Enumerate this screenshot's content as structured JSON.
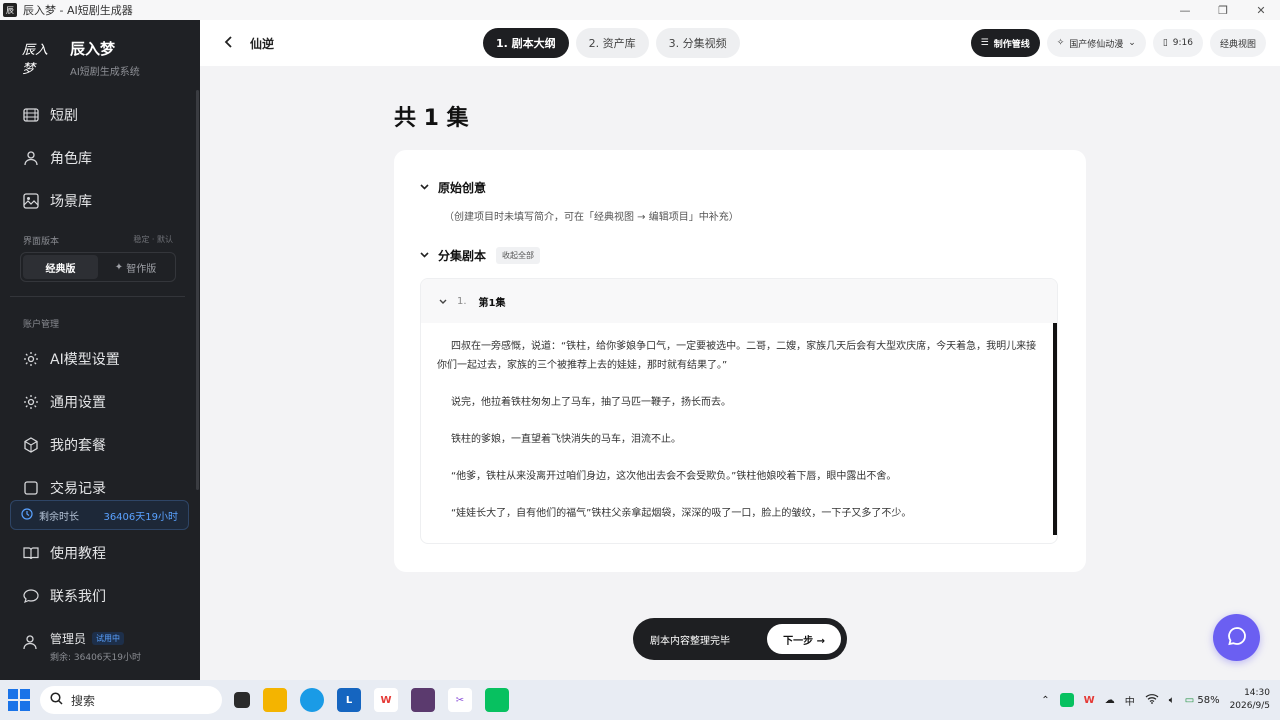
{
  "window": {
    "title": "辰入梦 - AI短剧生成器",
    "controls": [
      "—",
      "❐",
      "✕"
    ]
  },
  "sidebar": {
    "brand": {
      "logo": "辰入梦",
      "name": "辰入梦",
      "subtitle": "AI短剧生成系统"
    },
    "nav": [
      {
        "label": "短剧",
        "icon": "film-icon"
      },
      {
        "label": "角色库",
        "icon": "person-icon"
      },
      {
        "label": "场景库",
        "icon": "image-icon"
      }
    ],
    "version": {
      "label": "界面版本",
      "meta": "稳定 · 默认",
      "options": [
        "经典版",
        "智作版"
      ],
      "selected": "经典版"
    },
    "account_label": "账户管理",
    "account_nav": [
      {
        "label": "AI模型设置",
        "icon": "gear-icon"
      },
      {
        "label": "通用设置",
        "icon": "gear-icon"
      },
      {
        "label": "我的套餐",
        "icon": "box-icon"
      },
      {
        "label": "交易记录",
        "icon": "receipt-icon"
      }
    ],
    "remaining": {
      "label": "剩余时长",
      "value": "36406天19小时"
    },
    "bottom_nav": [
      {
        "label": "使用教程",
        "icon": "book-icon"
      },
      {
        "label": "联系我们",
        "icon": "chat-icon"
      }
    ],
    "user": {
      "name": "管理员",
      "badge": "试用中",
      "sub": "剩余: 36406天19小时"
    }
  },
  "header": {
    "project": "仙逆",
    "steps": [
      "1. 剧本大纲",
      "2. 资产库",
      "3. 分集视频"
    ],
    "active_step": 0,
    "pipeline": "制作管线",
    "style": "国产修仙动漫",
    "ratio": "9:16",
    "classic_view": "经典视图"
  },
  "main": {
    "title": "共 1 集",
    "original_idea": {
      "label": "原始创意",
      "hint": "（创建项目时未填写简介，可在「经典视图 → 编辑项目」中补充）"
    },
    "episodes_section": {
      "label": "分集剧本",
      "collapse_all": "收起全部"
    },
    "episode": {
      "num": "1.",
      "title": "第1集",
      "paragraphs": [
        "四叔在一旁感慨，说道：“铁柱，给你爹娘争口气，一定要被选中。二哥，二嫂，家族几天后会有大型欢庆席，今天着急，我明儿来接你们一起过去，家族的三个被推荐上去的娃娃，那时就有结果了。”",
        "说完，他拉着铁柱匆匆上了马车，抽了马匹一鞭子，扬长而去。",
        "铁柱的爹娘，一直望着飞快消失的马车，泪流不止。",
        "“他爹，铁柱从来没离开过咱们身边，这次他出去会不会受欺负。”铁柱他娘咬着下唇，眼中露出不舍。",
        "“娃娃长大了，自有他们的福气”铁柱父亲拿起烟袋，深深的吸了一口，脸上的皱纹，一下子又多了不少。"
      ]
    }
  },
  "action_bar": {
    "text": "剧本内容整理完毕",
    "next": "下一步 →"
  },
  "taskbar": {
    "search": "搜索",
    "tray": {
      "lang": "中",
      "battery": "58%",
      "time": "14:30",
      "date": "2026/9/5"
    }
  }
}
